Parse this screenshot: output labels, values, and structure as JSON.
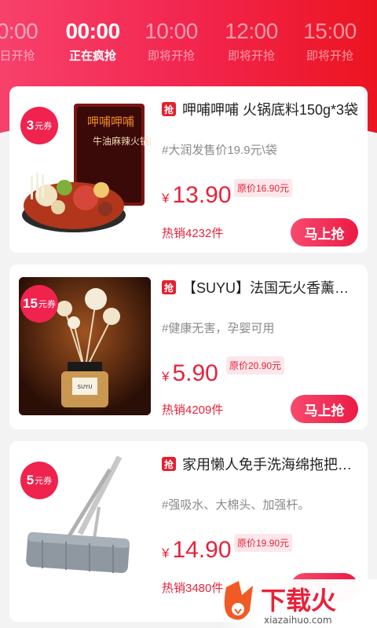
{
  "timebar": {
    "slots": [
      {
        "time": "0:00",
        "status": "日开抢"
      },
      {
        "time": "00:00",
        "status": "正在疯抢"
      },
      {
        "time": "10:00",
        "status": "即将开抢"
      },
      {
        "time": "12:00",
        "status": "即将开抢"
      },
      {
        "time": "15:00",
        "status": "即将开抢"
      }
    ]
  },
  "products": [
    {
      "coupon_value": "3",
      "coupon_unit": "元券",
      "badge": "抢",
      "title": "呷哺呷哺 火锅底料150g*3袋",
      "tag": "#大润发售价19.9元\\袋",
      "currency": "¥",
      "price": "13.90",
      "original_price": "原价16.90元",
      "sales": "热销4232件",
      "buy_label": "马上抢"
    },
    {
      "coupon_value": "15",
      "coupon_unit": "元券",
      "badge": "抢",
      "title": "【SUYU】法国无火香薰精油",
      "tag": "#健康无害，孕婴可用",
      "currency": "¥",
      "price": "5.90",
      "original_price": "原价20.90元",
      "sales": "热销4209件",
      "buy_label": "马上抢"
    },
    {
      "coupon_value": "5",
      "coupon_unit": "元券",
      "badge": "抢",
      "title": "家用懒人免手洗海绵拖把一个",
      "tag": "#强吸水、大棉头、加强杆。",
      "currency": "¥",
      "price": "14.90",
      "original_price": "原价19.90元",
      "sales": "热销3480件",
      "buy_label": "马上抢"
    }
  ],
  "package_labels": {
    "hotpot_top": "呷哺呷哺",
    "hotpot_side": "牛油麻辣火锅底料",
    "bottle_label": "SUYU"
  },
  "watermark": {
    "text": "下载火",
    "domain": "xiazaihuo.com"
  },
  "colors": {
    "accent": "#e8223a",
    "header_start": "#f7416b",
    "header_end": "#ec1420"
  }
}
